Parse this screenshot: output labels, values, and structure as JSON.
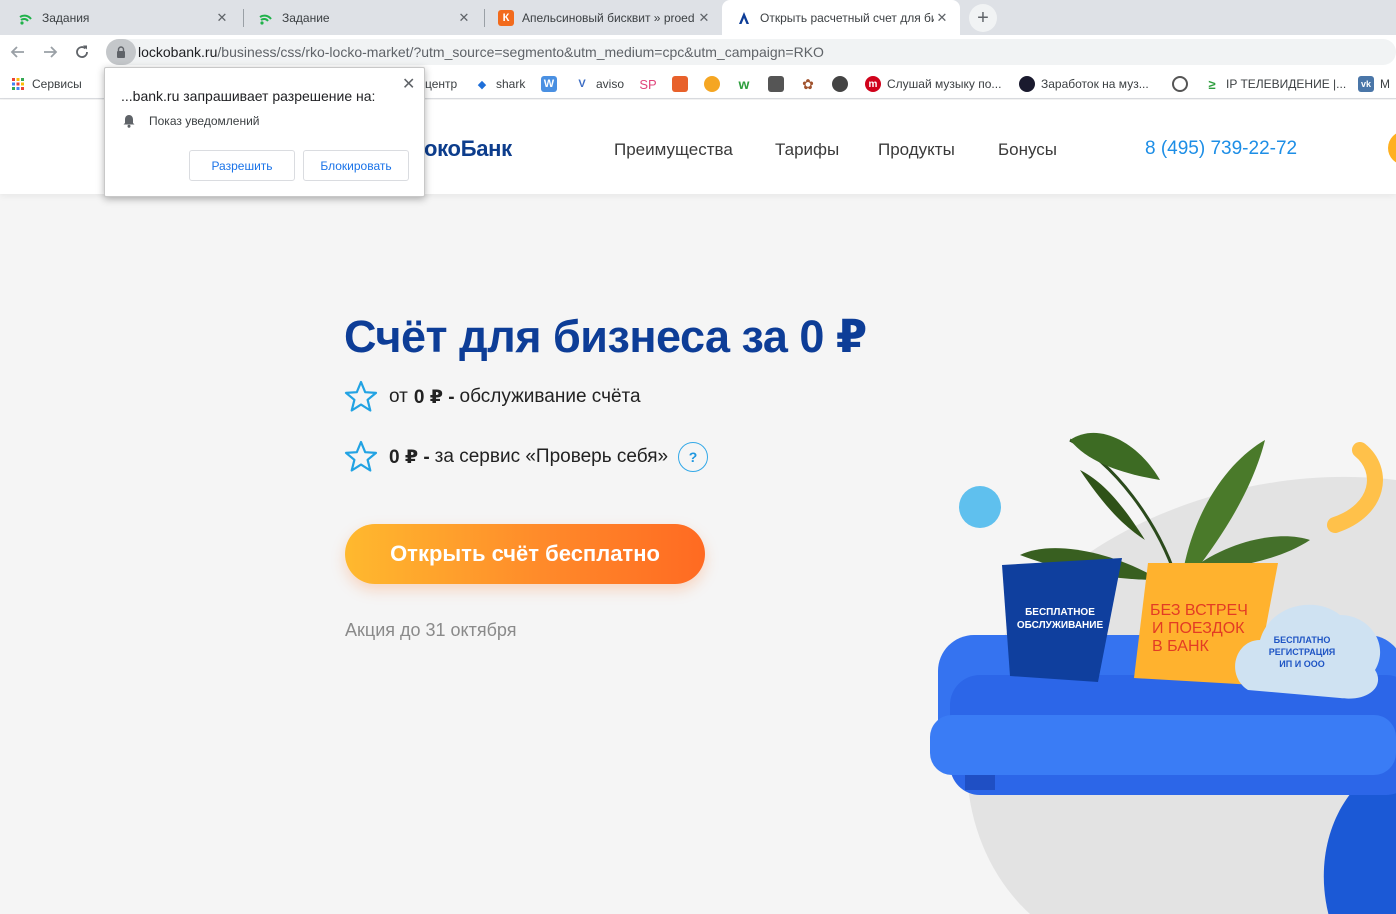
{
  "browser": {
    "tabs": [
      {
        "title": "Задания",
        "icon": "wifi-icon",
        "color": "#20b24a"
      },
      {
        "title": "Задание",
        "icon": "wifi-icon",
        "color": "#20b24a"
      },
      {
        "title": "Апельсиновый бисквит » proed",
        "icon": "proed-icon",
        "color": "#f26b1d"
      },
      {
        "title": "Открыть расчетный счет для би",
        "icon": "locko-icon",
        "color": "#0d3d97"
      }
    ],
    "url_host": "lockobank.ru",
    "url_path": "/business/css/rko-locko-market/?utm_source=segmento&utm_medium=cpc&utm_campaign=RKO",
    "bookmarks": {
      "services": "Сервисы",
      "center": "центр",
      "shark": "shark",
      "w": "W",
      "aviso": "aviso",
      "sp": "SP",
      "music": "Слушай музыку по...",
      "earn": "Заработок на муз...",
      "iptv": "IP ТЕЛЕВИДЕНИЕ |...",
      "m": "M"
    }
  },
  "permission": {
    "title": "...bank.ru запрашивает разрешение на:",
    "item": "Показ уведомлений",
    "allow": "Разрешить",
    "block": "Блокировать"
  },
  "header": {
    "logo": "окоБанк",
    "nav": [
      "Преимущества",
      "Тарифы",
      "Продукты",
      "Бонусы"
    ],
    "phone": "8 (495) 739-22-72"
  },
  "hero": {
    "title": "Счёт для бизнеса за 0 ₽",
    "feature1_prefix": "от",
    "feature1_bold": "0 ₽ -",
    "feature1_text": "обслуживание счёта",
    "feature2_bold": "0 ₽ -",
    "feature2_text": "за сервис «Проверь себя»",
    "help": "?",
    "cta": "Открыть счёт бесплатно",
    "promo": "Акция до 31 октября"
  },
  "illustration": {
    "pillow1": [
      "БЕСПЛАТНОЕ",
      "ОБСЛУЖИВАНИЕ"
    ],
    "pillow2": [
      "БЕЗ ВСТРЕЧ",
      "И ПОЕЗДОК",
      "В БАНК"
    ],
    "pillow3": [
      "БЕСПЛАТНО",
      "РЕГИСТРАЦИЯ",
      "ИП И ООО"
    ]
  },
  "colors": {
    "brand": "#0d3d97",
    "accent": "#ff8a2a",
    "phone": "#1d8ee6",
    "sofa": "#2f6ef0"
  }
}
